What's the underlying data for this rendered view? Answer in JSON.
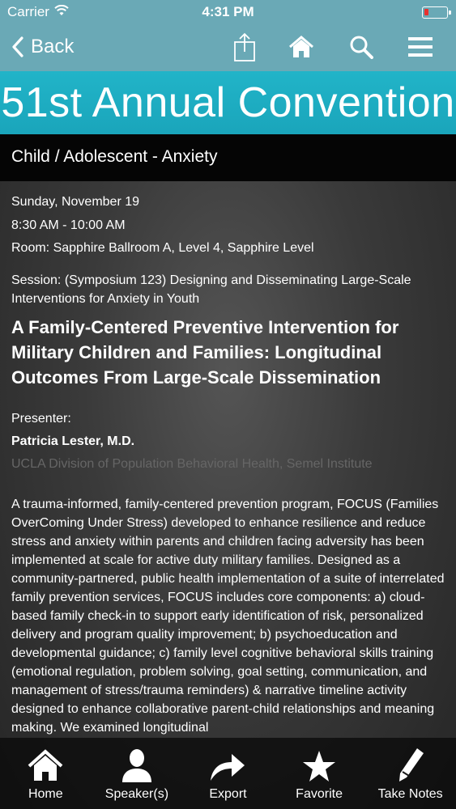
{
  "status_bar": {
    "carrier": "Carrier",
    "time": "4:31 PM",
    "battery_color": "#e8312f"
  },
  "nav": {
    "back_label": "Back",
    "icons": [
      "share-icon",
      "home-icon",
      "search-icon",
      "menu-icon"
    ]
  },
  "banner": {
    "title": "51st Annual Convention"
  },
  "section": {
    "title": "Child / Adolescent - Anxiety"
  },
  "event": {
    "date": "Sunday, November 19",
    "time": "8:30 AM - 10:00 AM",
    "room": "Room: Sapphire Ballroom A, Level 4, Sapphire Level",
    "session": "Session: (Symposium 123) Designing and Disseminating Large-Scale Interventions for Anxiety in Youth",
    "title": "A Family-Centered Preventive Intervention for Military Children and Families: Longitudinal Outcomes From Large-Scale Dissemination",
    "presenter_label": "Presenter:",
    "presenter_name": "Patricia Lester, M.D.",
    "affiliation": "UCLA Division of Population Behavioral Health, Semel Institute",
    "abstract": "A trauma-informed, family-centered prevention program, FOCUS (Families OverComing Under Stress) developed to enhance resilience and reduce stress and anxiety within parents and children facing adversity has been implemented at scale for active duty military families.  Designed as a community-partnered, public health implementation of a suite of interrelated family prevention services, FOCUS includes core components:  a) cloud-based family check-in to support early identification of risk, personalized delivery and program quality improvement; b) psychoeducation and developmental guidance; c) family level cognitive behavioral skills training (emotional regulation, problem solving, goal setting, communication, and management of stress/trauma reminders) & narrative timeline activity designed to enhance collaborative parent-child relationships and meaning making. We examined longitudinal"
  },
  "tabbar": {
    "home": "Home",
    "speakers": "Speaker(s)",
    "export": "Export",
    "favorite": "Favorite",
    "notes": "Take Notes"
  },
  "colors": {
    "header": "#6aa9b6",
    "banner": "#1fb0c4",
    "section_bar": "#050505"
  }
}
